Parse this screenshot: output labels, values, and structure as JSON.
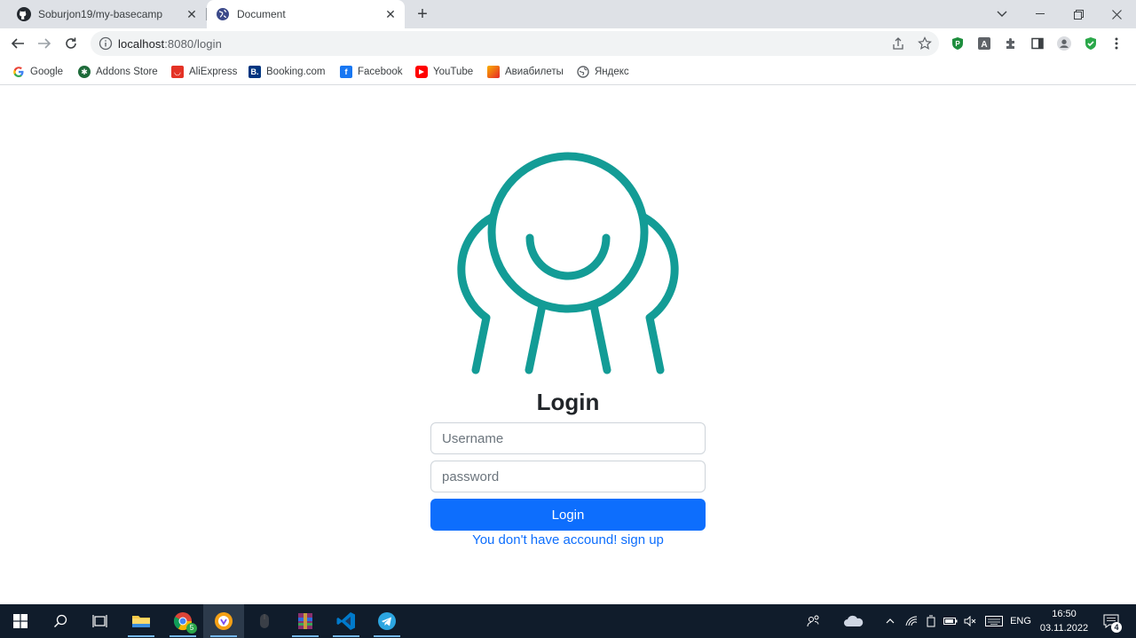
{
  "browser": {
    "tabs": [
      {
        "title": "Soburjon19/my-basecamp",
        "icon": "github-icon"
      },
      {
        "title": "Document",
        "icon": "globe-icon",
        "active": true
      }
    ],
    "address": {
      "host": "localhost",
      "path": ":8080/login"
    },
    "bookmarks": [
      {
        "label": "Google",
        "icon": "google-icon"
      },
      {
        "label": "Addons Store",
        "icon": "addons-store-icon"
      },
      {
        "label": "AliExpress",
        "icon": "aliexpress-icon"
      },
      {
        "label": "Booking.com",
        "icon": "booking-icon"
      },
      {
        "label": "Facebook",
        "icon": "facebook-icon"
      },
      {
        "label": "YouTube",
        "icon": "youtube-icon"
      },
      {
        "label": "Авиабилеты",
        "icon": "aviabilety-icon"
      },
      {
        "label": "Яндекс",
        "icon": "yandex-icon"
      }
    ]
  },
  "page": {
    "title": "Login",
    "username_placeholder": "Username",
    "password_placeholder": "password",
    "button_label": "Login",
    "signup_link": "You don't have accound! sign up",
    "accent_color": "#0d6efd",
    "logo_color": "#139c96"
  },
  "taskbar": {
    "lang": "ENG",
    "time": "16:50",
    "date": "03.11.2022",
    "chrome_badge": "5",
    "notification_count": "4"
  }
}
